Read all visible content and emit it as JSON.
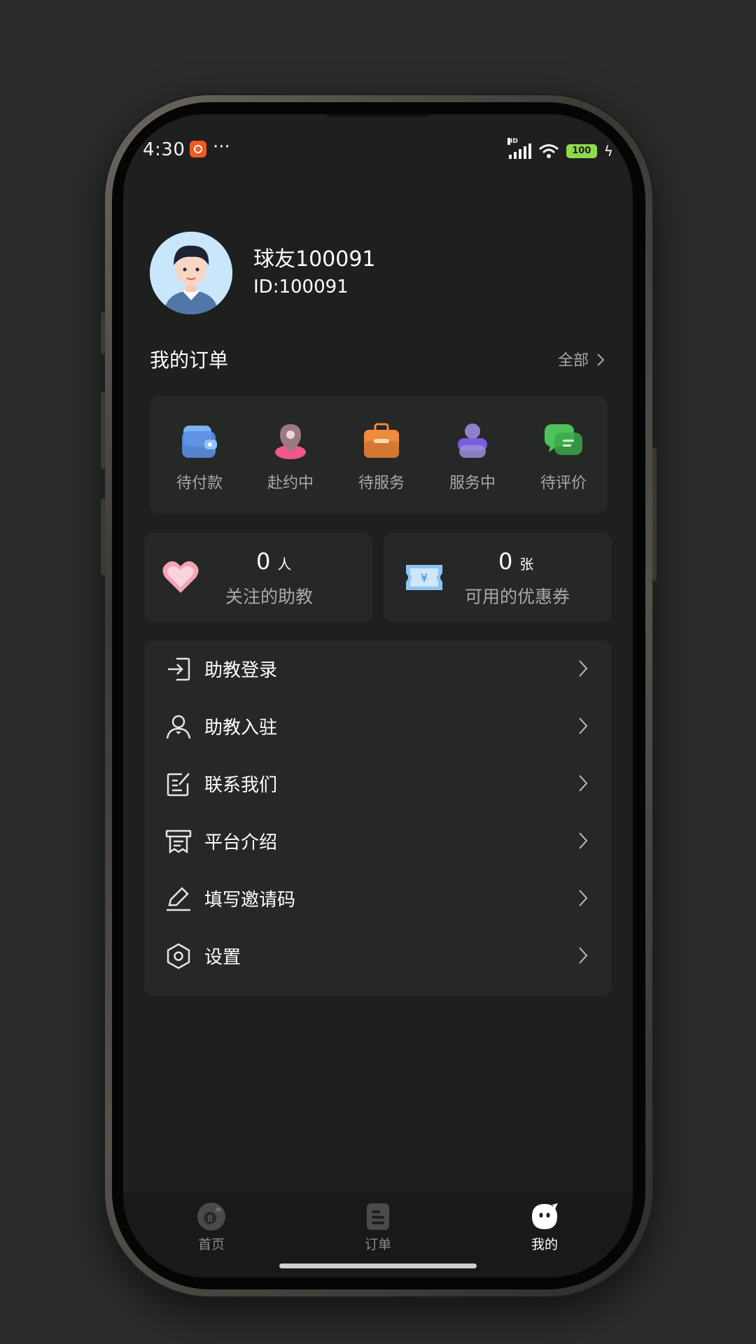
{
  "status_bar": {
    "time": "4:30",
    "hd": "HD",
    "battery": "100"
  },
  "profile": {
    "nickname": "球友100091",
    "id_text": "ID:100091"
  },
  "orders": {
    "title": "我的订单",
    "all_label": "全部",
    "items": [
      {
        "label": "待付款",
        "icon": "wallet-icon"
      },
      {
        "label": "赴约中",
        "icon": "location-pin-icon"
      },
      {
        "label": "待服务",
        "icon": "briefcase-icon"
      },
      {
        "label": "服务中",
        "icon": "person-icon"
      },
      {
        "label": "待评价",
        "icon": "chat-bubbles-icon"
      }
    ]
  },
  "stats": {
    "followed": {
      "value": "0",
      "unit": "人",
      "label": "关注的助教",
      "icon": "heart-icon"
    },
    "coupons": {
      "value": "0",
      "unit": "张",
      "label": "可用的优惠券",
      "icon": "coupon-icon"
    }
  },
  "menu": [
    {
      "label": "助教登录",
      "icon": "login-icon"
    },
    {
      "label": "助教入驻",
      "icon": "user-join-icon"
    },
    {
      "label": "联系我们",
      "icon": "contact-edit-icon"
    },
    {
      "label": "平台介绍",
      "icon": "platform-info-icon"
    },
    {
      "label": "填写邀请码",
      "icon": "pen-icon"
    },
    {
      "label": "设置",
      "icon": "settings-icon"
    }
  ],
  "tab_bar": {
    "tabs": [
      {
        "label": "首页",
        "icon": "billiard-ball-icon",
        "active": false
      },
      {
        "label": "订单",
        "icon": "order-doc-icon",
        "active": false
      },
      {
        "label": "我的",
        "icon": "mascot-icon",
        "active": true
      }
    ]
  },
  "colors": {
    "background": "#2b2b2b",
    "screen": "#1e1f1f",
    "card": "#262727",
    "text_primary": "#ffffff",
    "text_secondary": "#a9a9a9",
    "battery": "#8fd94c",
    "status_app": "#f05a22"
  }
}
